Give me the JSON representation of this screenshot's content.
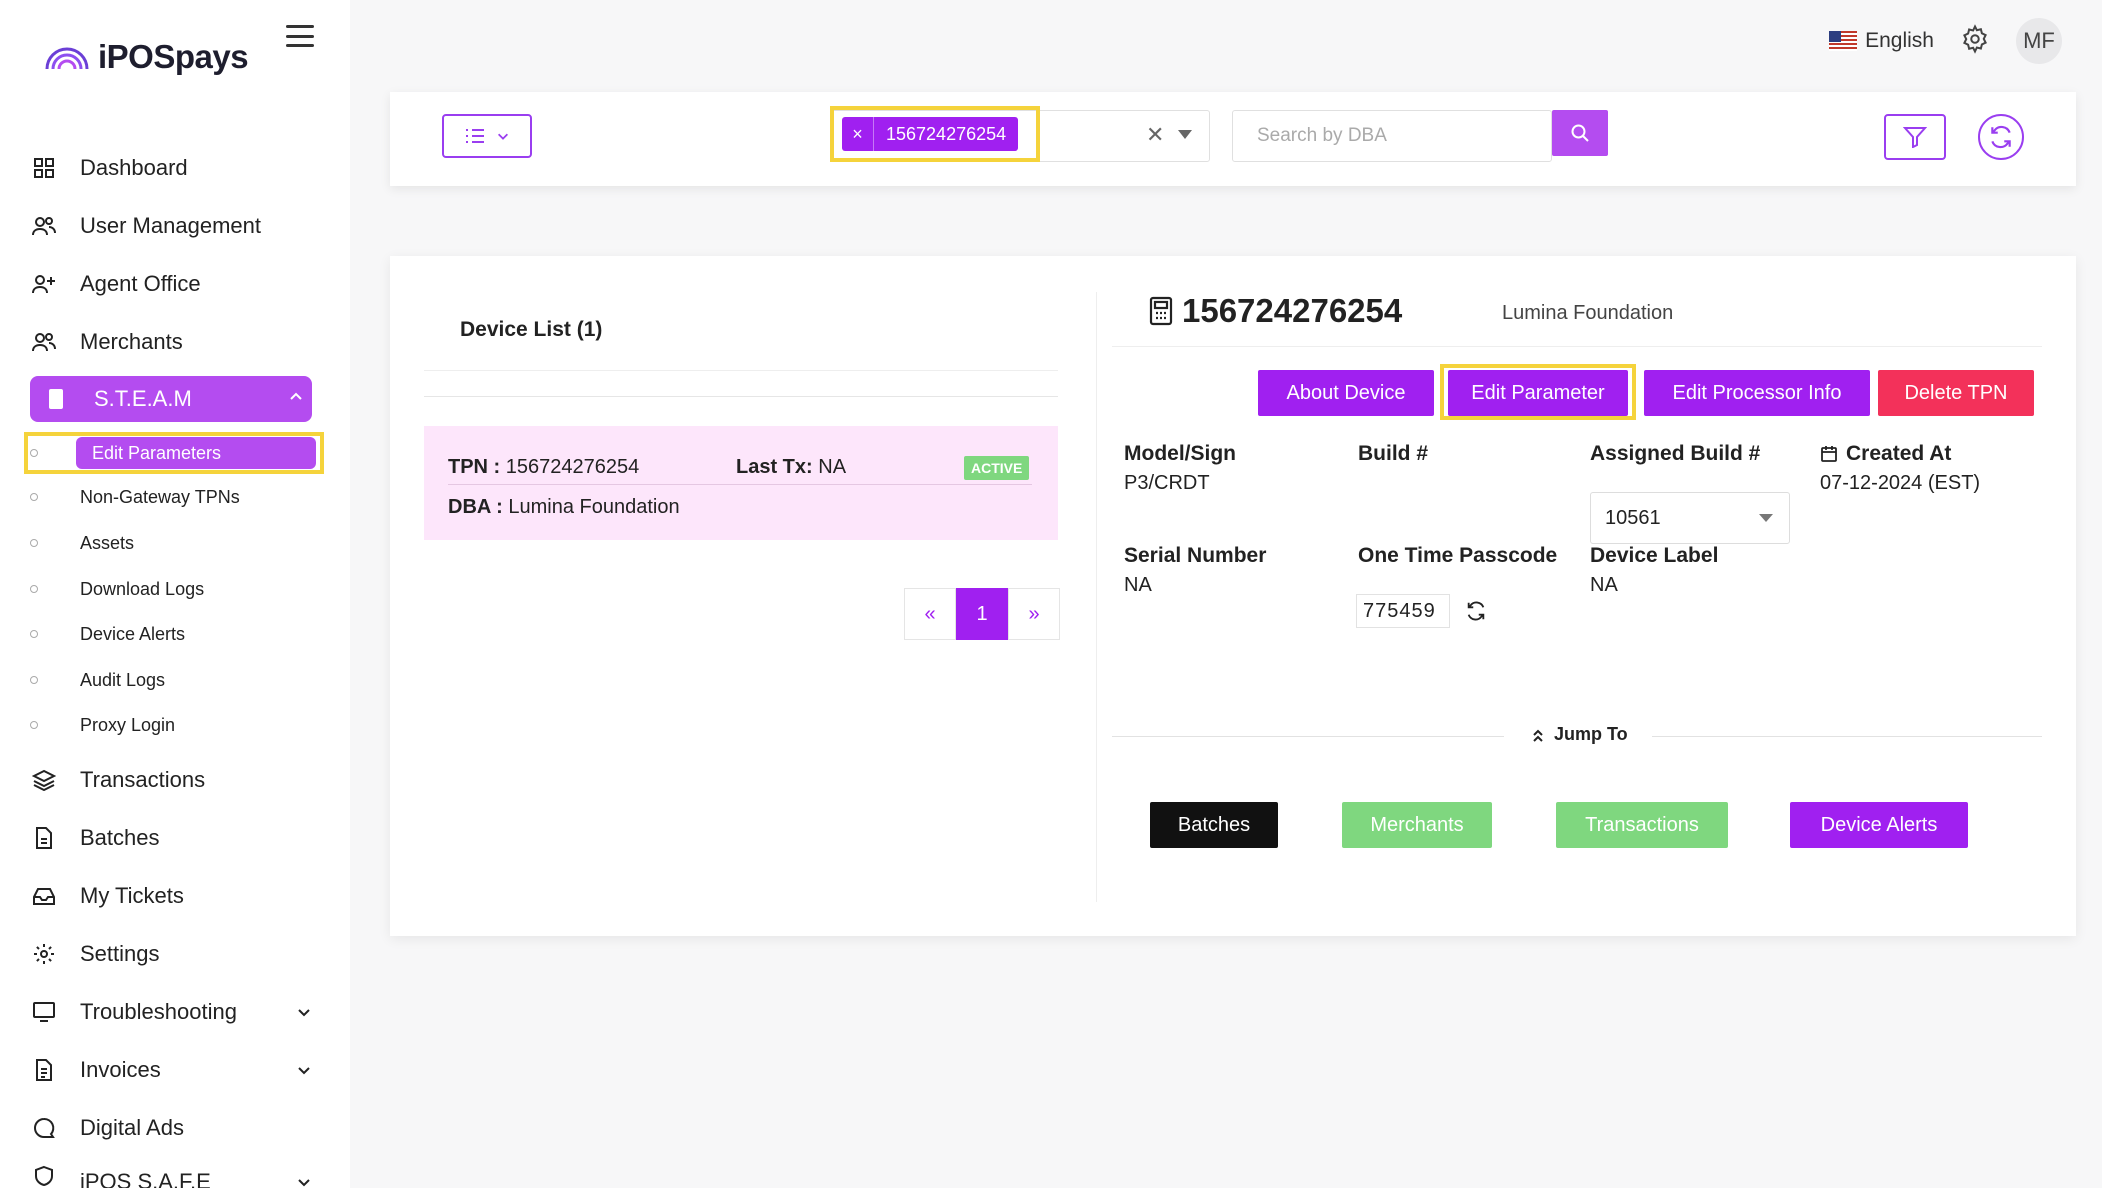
{
  "brand": {
    "name": "iPOSpays"
  },
  "header": {
    "language": "English",
    "avatar_initials": "MF"
  },
  "sidebar": {
    "items": [
      {
        "label": "Dashboard",
        "icon": "grid-icon"
      },
      {
        "label": "User Management",
        "icon": "users-icon"
      },
      {
        "label": "Agent Office",
        "icon": "user-plus-icon"
      },
      {
        "label": "Merchants",
        "icon": "users-icon"
      },
      {
        "label": "S.T.E.A.M",
        "icon": "device-icon"
      },
      {
        "label": "Transactions",
        "icon": "layers-icon"
      },
      {
        "label": "Batches",
        "icon": "file-icon"
      },
      {
        "label": "My Tickets",
        "icon": "inbox-icon"
      },
      {
        "label": "Settings",
        "icon": "gear-icon"
      },
      {
        "label": "Troubleshooting",
        "icon": "monitor-icon"
      },
      {
        "label": "Invoices",
        "icon": "document-icon"
      },
      {
        "label": "Digital Ads",
        "icon": "chat-icon"
      },
      {
        "label": "iPOS S.A.F.E",
        "icon": "shield-icon"
      }
    ],
    "steam_subitems": [
      "Edit Parameters",
      "Non-Gateway TPNs",
      "Assets",
      "Download Logs",
      "Device Alerts",
      "Audit Logs",
      "Proxy Login"
    ]
  },
  "filter": {
    "tpn_chip": "156724276254",
    "search_placeholder": "Search by DBA"
  },
  "device_list": {
    "title": "Device List (1)",
    "row": {
      "tpn_label": "TPN :",
      "tpn_value": "156724276254",
      "last_tx_label": "Last Tx:",
      "last_tx_value": "NA",
      "status": "ACTIVE",
      "dba_label": "DBA :",
      "dba_value": "Lumina Foundation"
    },
    "pager": {
      "prev": "«",
      "current": "1",
      "next": "»"
    }
  },
  "device": {
    "tpn": "156724276254",
    "dba": "Lumina Foundation",
    "buttons": {
      "about": "About Device",
      "edit_parameter": "Edit Parameter",
      "edit_processor": "Edit Processor Info",
      "delete": "Delete TPN"
    },
    "fields": {
      "model_label": "Model/Sign",
      "model_value": "P3/CRDT",
      "build_label": "Build #",
      "assigned_build_label": "Assigned Build #",
      "assigned_build_value": "10561",
      "created_label": "Created At",
      "created_value": "07-12-2024 (EST)",
      "serial_label": "Serial Number",
      "serial_value": "NA",
      "otp_label": "One Time Passcode",
      "otp_value": "775459",
      "device_label_label": "Device Label",
      "device_label_value": "NA"
    },
    "jump_to": {
      "label": "Jump To",
      "batches": "Batches",
      "merchants": "Merchants",
      "transactions": "Transactions",
      "alerts": "Device Alerts"
    }
  }
}
